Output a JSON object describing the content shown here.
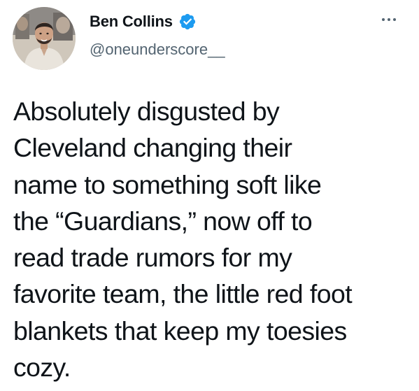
{
  "tweet": {
    "author": {
      "display_name": "Ben Collins",
      "handle": "@oneunderscore__",
      "verified": true,
      "verified_color": "#1d9bf0"
    },
    "more_icon": "more-horizontal-icon",
    "text": "Absolutely disgusted by\nCleveland changing their\nname to something soft like\nthe “Guardians,” now off to\nread trade rumors for my\nfavorite team, the little red foot\nblankets that keep my toesies\ncozy."
  }
}
